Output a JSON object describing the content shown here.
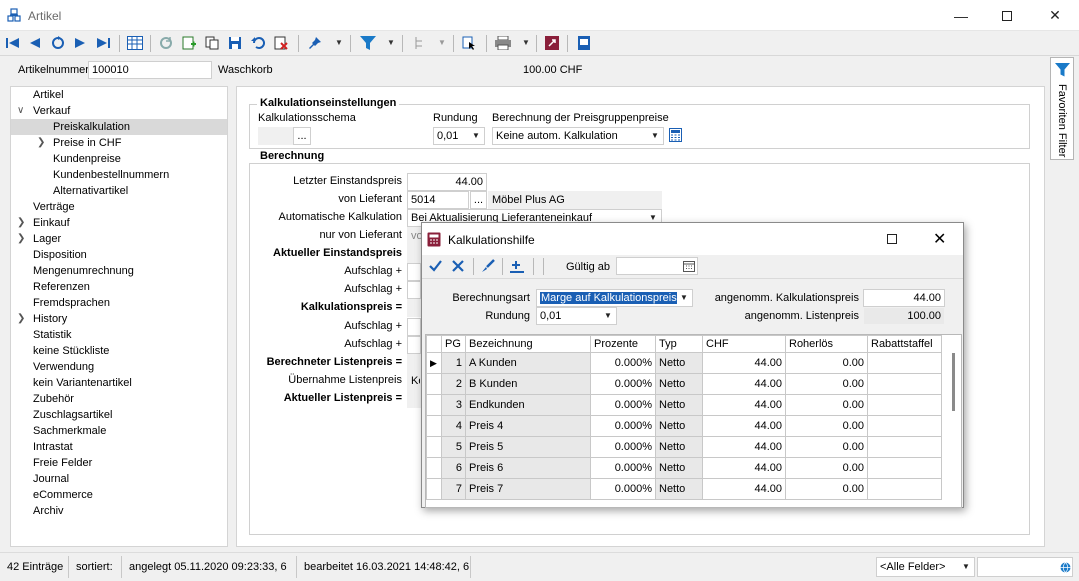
{
  "window": {
    "title": "Artikel"
  },
  "header": {
    "artikelnummer_label": "Artikelnummer",
    "artikelnummer_value": "100010",
    "description": "Waschkorb",
    "price": "100.00 CHF"
  },
  "tree": [
    {
      "label": "Artikel",
      "level": 0,
      "expander": false,
      "selected": false
    },
    {
      "label": "Verkauf",
      "level": 0,
      "expander": "open",
      "selected": false
    },
    {
      "label": "Preiskalkulation",
      "level": 1,
      "expander": false,
      "selected": true
    },
    {
      "label": "Preise in CHF",
      "level": 1,
      "expander": "closed",
      "selected": false
    },
    {
      "label": "Kundenpreise",
      "level": 1,
      "expander": false,
      "selected": false
    },
    {
      "label": "Kundenbestellnummern",
      "level": 1,
      "expander": false,
      "selected": false
    },
    {
      "label": "Alternativartikel",
      "level": 1,
      "expander": false,
      "selected": false
    },
    {
      "label": "Verträge",
      "level": 0,
      "expander": false,
      "selected": false
    },
    {
      "label": "Einkauf",
      "level": 0,
      "expander": "closed",
      "selected": false
    },
    {
      "label": "Lager",
      "level": 0,
      "expander": "closed",
      "selected": false
    },
    {
      "label": "Disposition",
      "level": 0,
      "expander": false,
      "selected": false
    },
    {
      "label": "Mengenumrechnung",
      "level": 0,
      "expander": false,
      "selected": false
    },
    {
      "label": "Referenzen",
      "level": 0,
      "expander": false,
      "selected": false
    },
    {
      "label": "Fremdsprachen",
      "level": 0,
      "expander": false,
      "selected": false
    },
    {
      "label": "History",
      "level": 0,
      "expander": "closed",
      "selected": false
    },
    {
      "label": "Statistik",
      "level": 0,
      "expander": false,
      "selected": false
    },
    {
      "label": "keine Stückliste",
      "level": 0,
      "expander": false,
      "selected": false
    },
    {
      "label": "Verwendung",
      "level": 0,
      "expander": false,
      "selected": false
    },
    {
      "label": "kein Variantenartikel",
      "level": 0,
      "expander": false,
      "selected": false
    },
    {
      "label": "Zubehör",
      "level": 0,
      "expander": false,
      "selected": false
    },
    {
      "label": "Zuschlagsartikel",
      "level": 0,
      "expander": false,
      "selected": false
    },
    {
      "label": "Sachmerkmale",
      "level": 0,
      "expander": false,
      "selected": false
    },
    {
      "label": "Intrastat",
      "level": 0,
      "expander": false,
      "selected": false
    },
    {
      "label": "Freie Felder",
      "level": 0,
      "expander": false,
      "selected": false
    },
    {
      "label": "Journal",
      "level": 0,
      "expander": false,
      "selected": false
    },
    {
      "label": "eCommerce",
      "level": 0,
      "expander": false,
      "selected": false
    },
    {
      "label": "Archiv",
      "level": 0,
      "expander": false,
      "selected": false
    }
  ],
  "kalkeinst": {
    "title": "Kalkulationseinstellungen",
    "schema_label": "Kalkulationsschema",
    "schema_btn": "...",
    "rundung_label": "Rundung",
    "rundung_value": "0,01",
    "berechnung_label": "Berechnung der Preisgruppenpreise",
    "berechnung_value": "Keine autom. Kalkulation"
  },
  "berechnung": {
    "title": "Berechnung",
    "letzter_label": "Letzter Einstandspreis",
    "letzter_value": "44.00",
    "lieferant_label": "von Lieferant",
    "lieferant_value": "5014",
    "lieferant_btn": "...",
    "lieferant_name": "Möbel Plus AG",
    "autokalk_label": "Automatische Kalkulation",
    "autokalk_value": "Bei Aktualisierung Lieferanteneinkauf",
    "nurvon_label": "nur von Lieferant",
    "nurvon_value": "vo",
    "akt_einstand_label": "Aktueller Einstandspreis",
    "aufschlag1_label": "Aufschlag +",
    "aufschlag2_label": "Aufschlag +",
    "kalkpreis_label": "Kalkulationspreis =",
    "aufschlag3_label": "Aufschlag +",
    "aufschlag4_label": "Aufschlag +",
    "ber_listenpreis_label": "Berechneter Listenpreis =",
    "uebernahme_label": "Übernahme Listenpreis",
    "uebernahme_value": "Ke",
    "akt_listenpreis_label": "Aktueller Listenpreis ="
  },
  "favorites": {
    "label": "Favoriten Filter"
  },
  "status": {
    "count": "42 Einträge",
    "sortiert": "sortiert:",
    "angelegt": "angelegt 05.11.2020 09:23:33,  6",
    "bearbeitet": "bearbeitet 16.03.2021 14:48:42,  6",
    "filter": "<Alle Felder>"
  },
  "dialog": {
    "title": "Kalkulationshilfe",
    "gueltig_label": "Gültig ab",
    "berechnungsart_label": "Berechnungsart",
    "berechnungsart_value": "Marge auf Kalkulationspreis",
    "rundung_label": "Rundung",
    "rundung_value": "0,01",
    "ang_kalk_label": "angenomm. Kalkulationspreis",
    "ang_kalk_value": "44.00",
    "ang_list_label": "angenomm. Listenpreis",
    "ang_list_value": "100.00",
    "columns": [
      "PG",
      "Bezeichnung",
      "Prozente",
      "Typ",
      "CHF",
      "Roherlös",
      "Rabattstaffel"
    ],
    "rows": [
      {
        "pg": "1",
        "bez": "A Kunden",
        "proz": "0.000%",
        "typ": "Netto",
        "chf": "44.00",
        "roh": "0.00",
        "rab": ""
      },
      {
        "pg": "2",
        "bez": "B Kunden",
        "proz": "0.000%",
        "typ": "Netto",
        "chf": "44.00",
        "roh": "0.00",
        "rab": ""
      },
      {
        "pg": "3",
        "bez": "Endkunden",
        "proz": "0.000%",
        "typ": "Netto",
        "chf": "44.00",
        "roh": "0.00",
        "rab": ""
      },
      {
        "pg": "4",
        "bez": "Preis 4",
        "proz": "0.000%",
        "typ": "Netto",
        "chf": "44.00",
        "roh": "0.00",
        "rab": ""
      },
      {
        "pg": "5",
        "bez": "Preis 5",
        "proz": "0.000%",
        "typ": "Netto",
        "chf": "44.00",
        "roh": "0.00",
        "rab": ""
      },
      {
        "pg": "6",
        "bez": "Preis 6",
        "proz": "0.000%",
        "typ": "Netto",
        "chf": "44.00",
        "roh": "0.00",
        "rab": ""
      },
      {
        "pg": "7",
        "bez": "Preis 7",
        "proz": "0.000%",
        "typ": "Netto",
        "chf": "44.00",
        "roh": "0.00",
        "rab": ""
      }
    ]
  },
  "colors": {
    "accent": "#1a5fb4",
    "selection": "#d9d9d9"
  }
}
